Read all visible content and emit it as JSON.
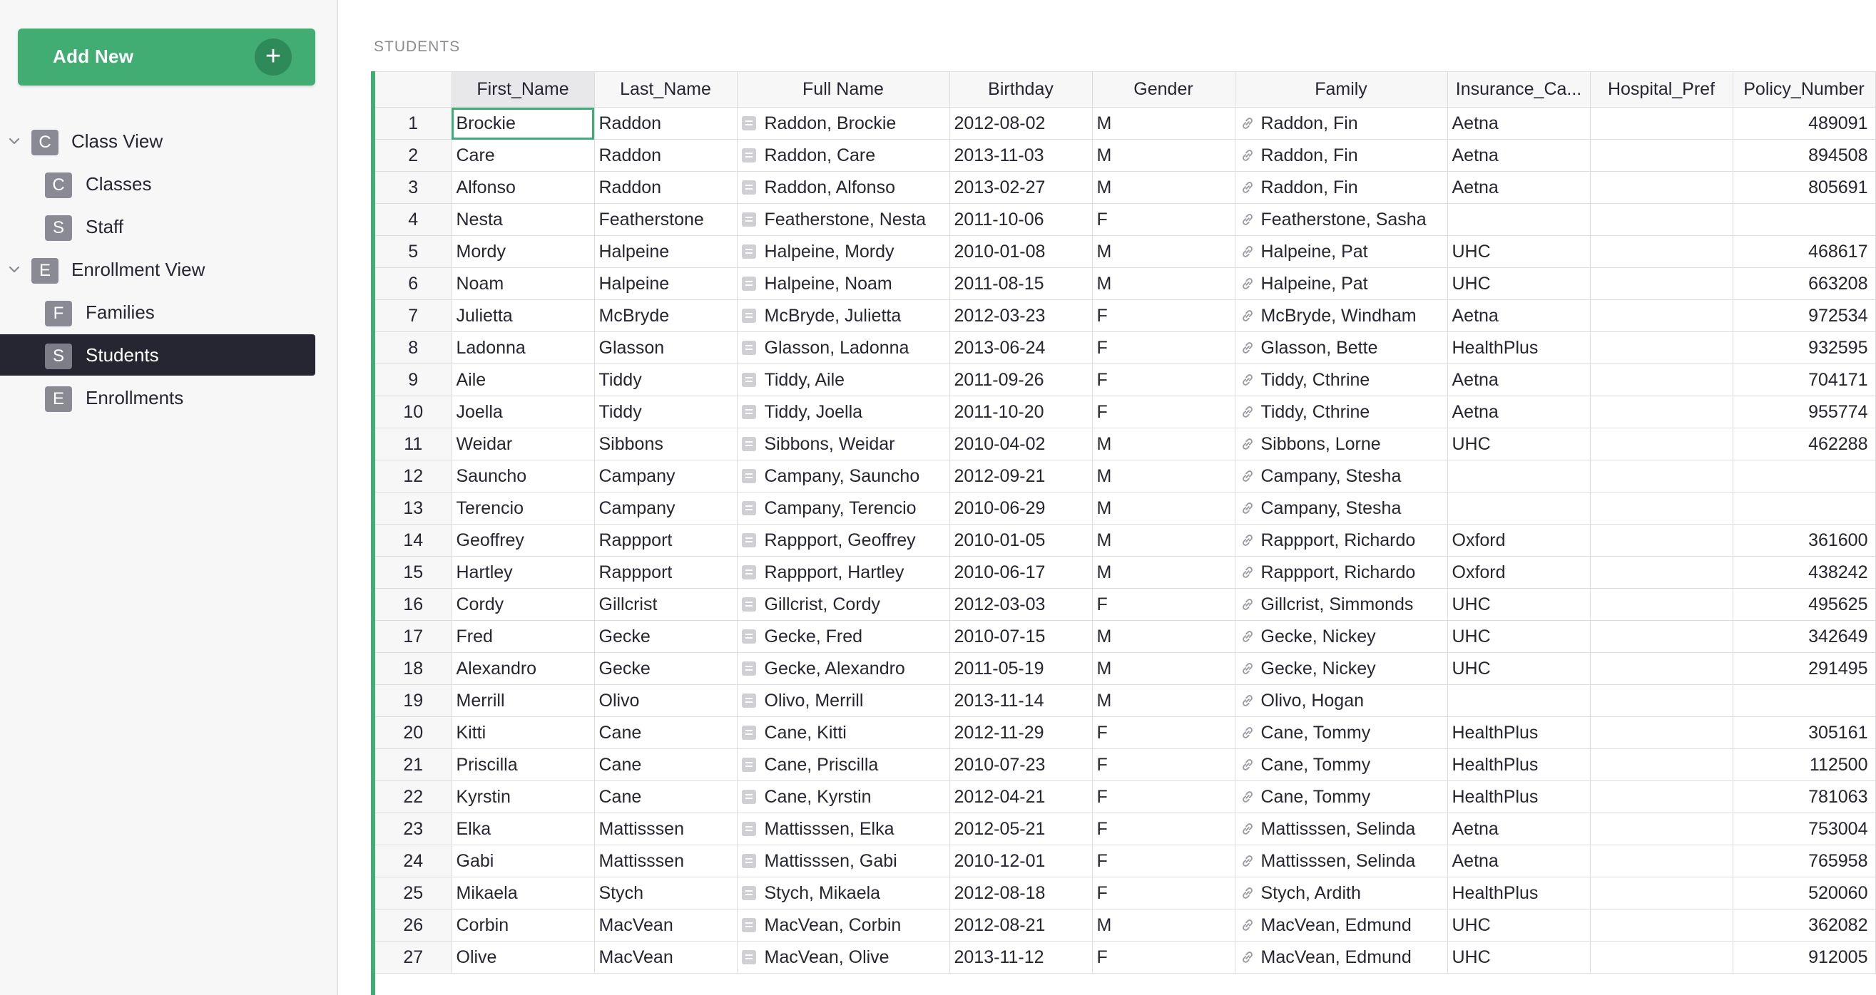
{
  "sidebar": {
    "add_new_label": "Add New",
    "add_new_plus": "+",
    "items": [
      {
        "badge": "C",
        "label": "Class View",
        "level": 0,
        "expanded": true
      },
      {
        "badge": "C",
        "label": "Classes",
        "level": 1
      },
      {
        "badge": "S",
        "label": "Staff",
        "level": 1
      },
      {
        "badge": "E",
        "label": "Enrollment View",
        "level": 0,
        "expanded": true
      },
      {
        "badge": "F",
        "label": "Families",
        "level": 1
      },
      {
        "badge": "S",
        "label": "Students",
        "level": 1,
        "active": true
      },
      {
        "badge": "E",
        "label": "Enrollments",
        "level": 1
      }
    ]
  },
  "page": {
    "title": "STUDENTS"
  },
  "table": {
    "columns": [
      "First_Name",
      "Last_Name",
      "Full Name",
      "Birthday",
      "Gender",
      "Family",
      "Insurance_Ca...",
      "Hospital_Pref",
      "Policy_Number"
    ],
    "rows": [
      {
        "n": "1",
        "first": "Brockie",
        "last": "Raddon",
        "full": "Raddon, Brockie",
        "bday": "2012-08-02",
        "gender": "M",
        "family": "Raddon, Fin",
        "ins": "Aetna",
        "hosp": "",
        "policy": "489091"
      },
      {
        "n": "2",
        "first": "Care",
        "last": "Raddon",
        "full": "Raddon, Care",
        "bday": "2013-11-03",
        "gender": "M",
        "family": "Raddon, Fin",
        "ins": "Aetna",
        "hosp": "",
        "policy": "894508"
      },
      {
        "n": "3",
        "first": "Alfonso",
        "last": "Raddon",
        "full": "Raddon, Alfonso",
        "bday": "2013-02-27",
        "gender": "M",
        "family": "Raddon, Fin",
        "ins": "Aetna",
        "hosp": "",
        "policy": "805691"
      },
      {
        "n": "4",
        "first": "Nesta",
        "last": "Featherstone",
        "full": "Featherstone, Nesta",
        "bday": "2011-10-06",
        "gender": "F",
        "family": "Featherstone, Sasha",
        "ins": "",
        "hosp": "",
        "policy": ""
      },
      {
        "n": "5",
        "first": "Mordy",
        "last": "Halpeine",
        "full": "Halpeine, Mordy",
        "bday": "2010-01-08",
        "gender": "M",
        "family": "Halpeine, Pat",
        "ins": "UHC",
        "hosp": "",
        "policy": "468617"
      },
      {
        "n": "6",
        "first": "Noam",
        "last": "Halpeine",
        "full": "Halpeine, Noam",
        "bday": "2011-08-15",
        "gender": "M",
        "family": "Halpeine, Pat",
        "ins": "UHC",
        "hosp": "",
        "policy": "663208"
      },
      {
        "n": "7",
        "first": "Julietta",
        "last": "McBryde",
        "full": "McBryde, Julietta",
        "bday": "2012-03-23",
        "gender": "F",
        "family": "McBryde, Windham",
        "ins": "Aetna",
        "hosp": "",
        "policy": "972534"
      },
      {
        "n": "8",
        "first": "Ladonna",
        "last": "Glasson",
        "full": "Glasson, Ladonna",
        "bday": "2013-06-24",
        "gender": "F",
        "family": "Glasson, Bette",
        "ins": "HealthPlus",
        "hosp": "",
        "policy": "932595"
      },
      {
        "n": "9",
        "first": "Aile",
        "last": "Tiddy",
        "full": "Tiddy, Aile",
        "bday": "2011-09-26",
        "gender": "F",
        "family": "Tiddy, Cthrine",
        "ins": "Aetna",
        "hosp": "",
        "policy": "704171"
      },
      {
        "n": "10",
        "first": "Joella",
        "last": "Tiddy",
        "full": "Tiddy, Joella",
        "bday": "2011-10-20",
        "gender": "F",
        "family": "Tiddy, Cthrine",
        "ins": "Aetna",
        "hosp": "",
        "policy": "955774"
      },
      {
        "n": "11",
        "first": "Weidar",
        "last": "Sibbons",
        "full": "Sibbons, Weidar",
        "bday": "2010-04-02",
        "gender": "M",
        "family": "Sibbons, Lorne",
        "ins": "UHC",
        "hosp": "",
        "policy": "462288"
      },
      {
        "n": "12",
        "first": "Sauncho",
        "last": "Campany",
        "full": "Campany, Sauncho",
        "bday": "2012-09-21",
        "gender": "M",
        "family": "Campany, Stesha",
        "ins": "",
        "hosp": "",
        "policy": ""
      },
      {
        "n": "13",
        "first": "Terencio",
        "last": "Campany",
        "full": "Campany, Terencio",
        "bday": "2010-06-29",
        "gender": "M",
        "family": "Campany, Stesha",
        "ins": "",
        "hosp": "",
        "policy": ""
      },
      {
        "n": "14",
        "first": "Geoffrey",
        "last": "Rappport",
        "full": "Rappport, Geoffrey",
        "bday": "2010-01-05",
        "gender": "M",
        "family": "Rappport, Richardo",
        "ins": "Oxford",
        "hosp": "",
        "policy": "361600"
      },
      {
        "n": "15",
        "first": "Hartley",
        "last": "Rappport",
        "full": "Rappport, Hartley",
        "bday": "2010-06-17",
        "gender": "M",
        "family": "Rappport, Richardo",
        "ins": "Oxford",
        "hosp": "",
        "policy": "438242"
      },
      {
        "n": "16",
        "first": "Cordy",
        "last": "Gillcrist",
        "full": "Gillcrist, Cordy",
        "bday": "2012-03-03",
        "gender": "F",
        "family": "Gillcrist, Simmonds",
        "ins": "UHC",
        "hosp": "",
        "policy": "495625"
      },
      {
        "n": "17",
        "first": "Fred",
        "last": "Gecke",
        "full": "Gecke, Fred",
        "bday": "2010-07-15",
        "gender": "M",
        "family": "Gecke, Nickey",
        "ins": "UHC",
        "hosp": "",
        "policy": "342649"
      },
      {
        "n": "18",
        "first": "Alexandro",
        "last": "Gecke",
        "full": "Gecke, Alexandro",
        "bday": "2011-05-19",
        "gender": "M",
        "family": "Gecke, Nickey",
        "ins": "UHC",
        "hosp": "",
        "policy": "291495"
      },
      {
        "n": "19",
        "first": "Merrill",
        "last": "Olivo",
        "full": "Olivo, Merrill",
        "bday": "2013-11-14",
        "gender": "M",
        "family": "Olivo, Hogan",
        "ins": "",
        "hosp": "",
        "policy": ""
      },
      {
        "n": "20",
        "first": "Kitti",
        "last": "Cane",
        "full": "Cane, Kitti",
        "bday": "2012-11-29",
        "gender": "F",
        "family": "Cane, Tommy",
        "ins": "HealthPlus",
        "hosp": "",
        "policy": "305161"
      },
      {
        "n": "21",
        "first": "Priscilla",
        "last": "Cane",
        "full": "Cane, Priscilla",
        "bday": "2010-07-23",
        "gender": "F",
        "family": "Cane, Tommy",
        "ins": "HealthPlus",
        "hosp": "",
        "policy": "112500"
      },
      {
        "n": "22",
        "first": "Kyrstin",
        "last": "Cane",
        "full": "Cane, Kyrstin",
        "bday": "2012-04-21",
        "gender": "F",
        "family": "Cane, Tommy",
        "ins": "HealthPlus",
        "hosp": "",
        "policy": "781063"
      },
      {
        "n": "23",
        "first": "Elka",
        "last": "Mattisssen",
        "full": "Mattisssen, Elka",
        "bday": "2012-05-21",
        "gender": "F",
        "family": "Mattisssen, Selinda",
        "ins": "Aetna",
        "hosp": "",
        "policy": "753004"
      },
      {
        "n": "24",
        "first": "Gabi",
        "last": "Mattisssen",
        "full": "Mattisssen, Gabi",
        "bday": "2010-12-01",
        "gender": "F",
        "family": "Mattisssen, Selinda",
        "ins": "Aetna",
        "hosp": "",
        "policy": "765958"
      },
      {
        "n": "25",
        "first": "Mikaela",
        "last": "Stych",
        "full": "Stych, Mikaela",
        "bday": "2012-08-18",
        "gender": "F",
        "family": "Stych, Ardith",
        "ins": "HealthPlus",
        "hosp": "",
        "policy": "520060"
      },
      {
        "n": "26",
        "first": "Corbin",
        "last": "MacVean",
        "full": "MacVean, Corbin",
        "bday": "2012-08-21",
        "gender": "M",
        "family": "MacVean, Edmund",
        "ins": "UHC",
        "hosp": "",
        "policy": "362082"
      },
      {
        "n": "27",
        "first": "Olive",
        "last": "MacVean",
        "full": "MacVean, Olive",
        "bday": "2013-11-12",
        "gender": "F",
        "family": "MacVean, Edmund",
        "ins": "UHC",
        "hosp": "",
        "policy": "912005"
      }
    ]
  },
  "icons": {
    "formula": "formula-icon",
    "link": "link-icon",
    "chevron": "chevron-down-icon",
    "plus": "plus-icon"
  },
  "colors": {
    "accent": "#41ad72",
    "active_nav_bg": "#262633",
    "badge_bg": "#8a8a95"
  }
}
